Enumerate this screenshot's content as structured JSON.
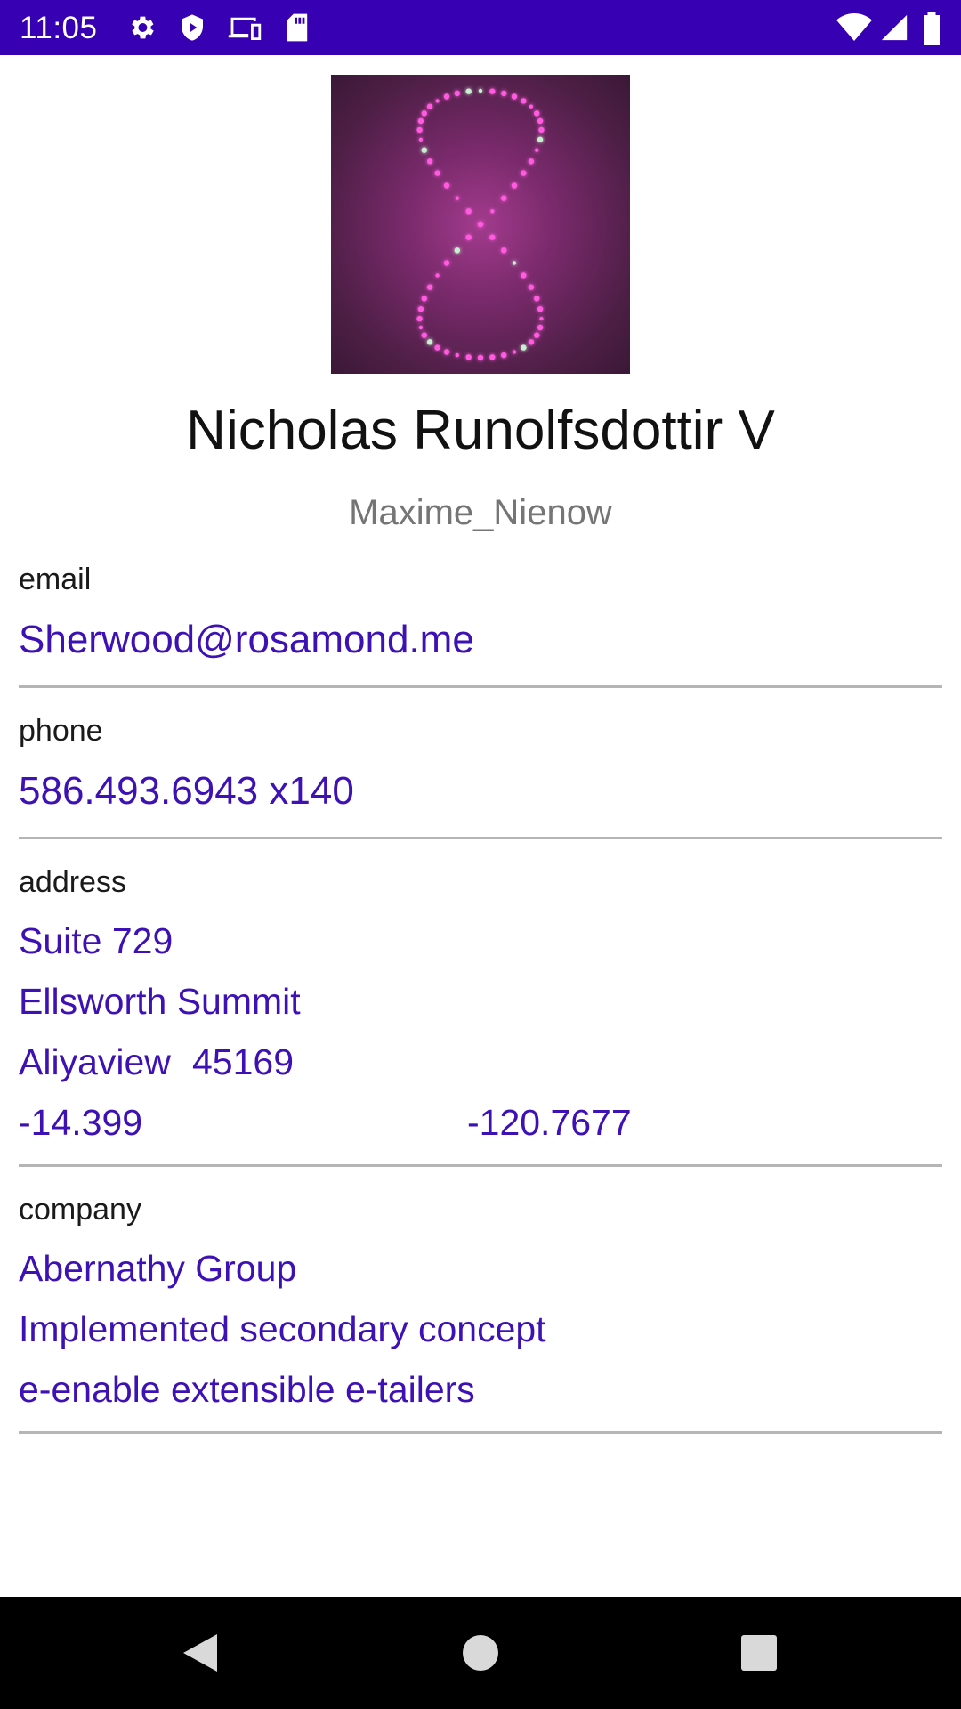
{
  "status_bar": {
    "time": "11:05",
    "icons_left": [
      "settings-icon",
      "shield-play-icon",
      "devices-icon",
      "sd-card-icon"
    ],
    "icons_right": [
      "wifi-icon",
      "signal-icon",
      "battery-icon"
    ],
    "background": "#3700b3"
  },
  "profile": {
    "name": "Nicholas Runolfsdottir V",
    "username": "Maxime_Nienow"
  },
  "email": {
    "label": "email",
    "value": "Sherwood@rosamond.me"
  },
  "phone": {
    "label": "phone",
    "value": "586.493.6943 x140"
  },
  "address": {
    "label": "address",
    "suite": "Suite 729",
    "street": "Ellsworth Summit",
    "city": "Aliyaview",
    "zipcode": "45169",
    "lat": "-14.399",
    "lng": "-120.7677"
  },
  "company": {
    "label": "company",
    "name": "Abernathy Group",
    "catch_phrase": "Implemented secondary concept",
    "bs": "e-enable extensible e-tailers"
  },
  "nav_bar": {
    "buttons": [
      "back-icon",
      "home-icon",
      "recents-icon"
    ]
  },
  "colors": {
    "accent": "#3d11b4",
    "label": "#1a1a1a",
    "secondary_text": "#757575",
    "divider": "#b5b5b5"
  }
}
